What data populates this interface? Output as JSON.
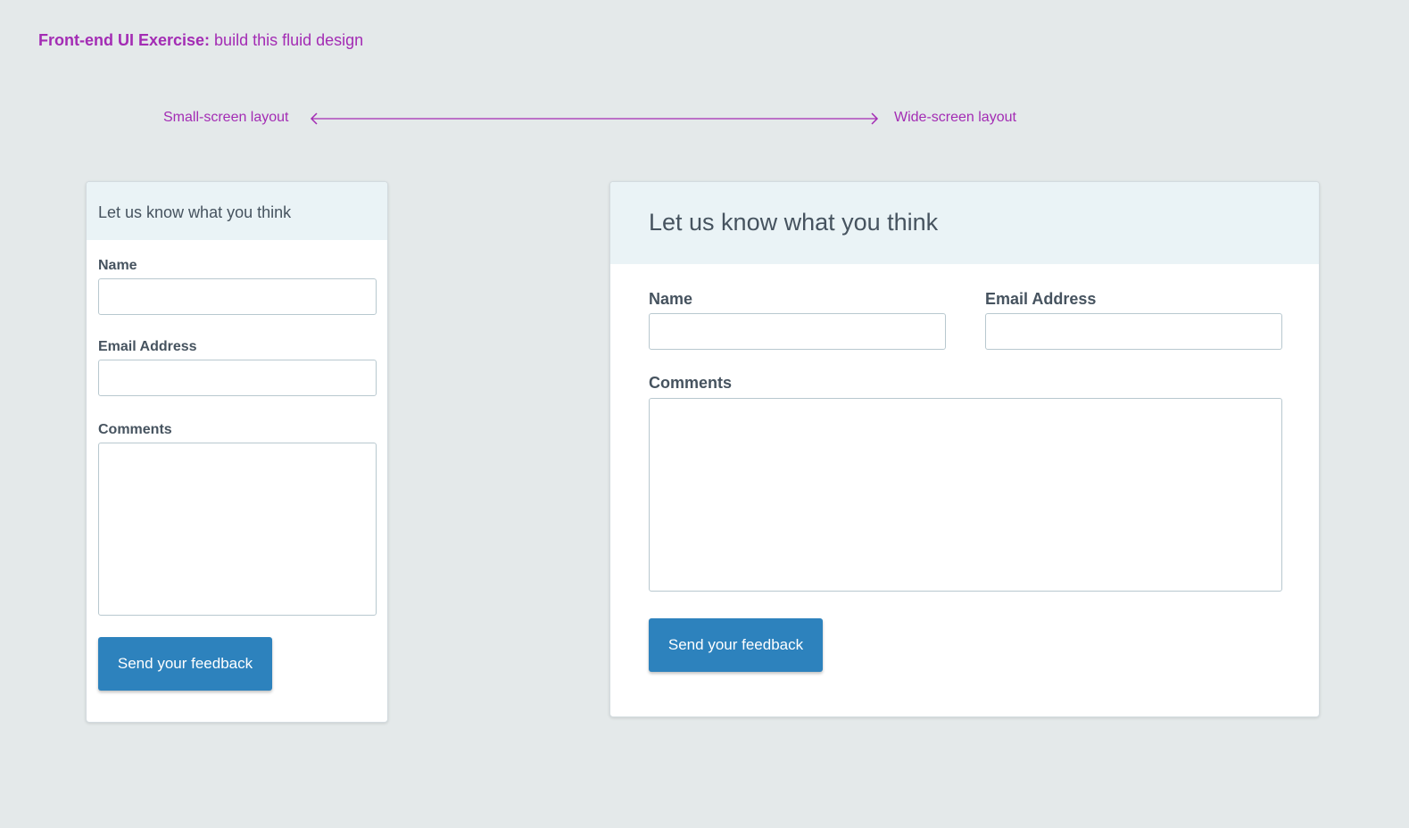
{
  "exercise": {
    "title_strong": "Front-end UI Exercise:",
    "title_rest": " build this fluid design"
  },
  "layouts": {
    "small_label": "Small-screen layout",
    "wide_label": "Wide-screen layout"
  },
  "colors": {
    "background": "#e4e9ea",
    "accent": "#a32cb4",
    "header_bg": "#eaf3f6",
    "button": "#2d82bd",
    "text": "#46535f"
  },
  "icons": {
    "arrow": "double-headed-arrow-icon"
  },
  "form": {
    "title": "Let us know what you think",
    "name_label": "Name",
    "name_value": "",
    "email_label": "Email Address",
    "email_value": "",
    "comments_label": "Comments",
    "comments_value": "",
    "submit_label": "Send your feedback"
  }
}
